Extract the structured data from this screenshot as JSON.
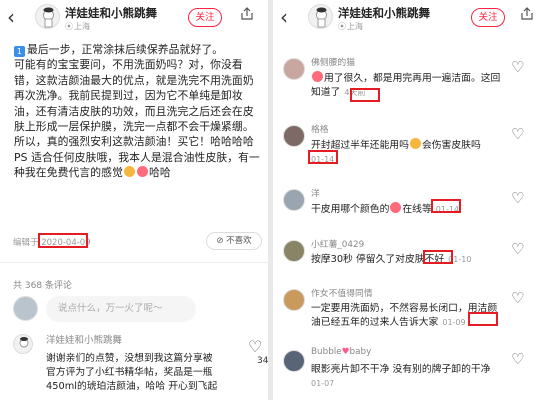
{
  "left": {
    "header": {
      "back_icon": "chevron-left-icon",
      "name": "洋娃娃和小熊跳舞",
      "location": "上海",
      "follow_label": "关注",
      "share_icon": "share-icon"
    },
    "post": {
      "p1_badge": "1",
      "p1": "最后一步，正常涂抹后续保养品就好了。",
      "p2a": "可能有的宝宝要问，不用洗面奶吗？对，你没看错，这款洁颜油最大的优点，就是洗完不用洗面奶再次洗净。我前民提到过，因为它不单纯是卸妆油，还有清洁皮肤的功效，而且洗完之后还会在皮肤上形成一层保护膜，洗完一点都不会干燥紧绷。",
      "p3": "所以，真的强烈安利这款洁颜油！买它！哈哈哈哈",
      "p4": "PS 适合任何皮肤哦，我本人是混合油性皮肤，有一种我在免费代言的感觉",
      "p4_tail": "哈哈",
      "edited_prefix": "编辑于",
      "edited_date": "2020-04-09",
      "nolike_label": "不喜欢"
    },
    "comments_total": "共 368 条评论",
    "input_placeholder": "说点什么，万一火了呢～",
    "reply": {
      "name": "洋娃娃和小熊跳舞",
      "text": "谢谢亲们的点赞，没想到我这篇分享被官方评为了小红书精华帖，奖品是一瓶450ml的琥珀洁颜油，哈哈 开心到飞起",
      "like_count": "34"
    }
  },
  "right": {
    "header": {
      "back_icon": "chevron-left-icon",
      "name": "洋娃娃和小熊跳舞",
      "location": "上海",
      "follow_label": "关注",
      "share_icon": "share-icon"
    },
    "comments": [
      {
        "name": "佛侧腰的猫",
        "text": "用了很久，都是用完再用一遍洁面。这回知道了",
        "date": "4天前"
      },
      {
        "name": "格格",
        "text": "开封超过半年还能用吗",
        "text_tail": "会伤害皮肤吗",
        "date": "01-14"
      },
      {
        "name": "洋",
        "text": "干皮用哪个颜色的",
        "text_tail": "在线等",
        "date": "01-14"
      },
      {
        "name": "小红薯_0429",
        "text": "按摩30秒 停留久了对皮肤不好",
        "date": "01-10"
      },
      {
        "name": "作女不值得同情",
        "text": "一定要用洗面奶，不然容易长闭口，用洁颜油已经五年的过来人告诉大家",
        "date": "01-09"
      },
      {
        "name": "Bubble",
        "name_tail": "baby",
        "text": "眼影亮片卸不干净 没有别的牌子卸的干净",
        "date": "01-07"
      }
    ]
  }
}
